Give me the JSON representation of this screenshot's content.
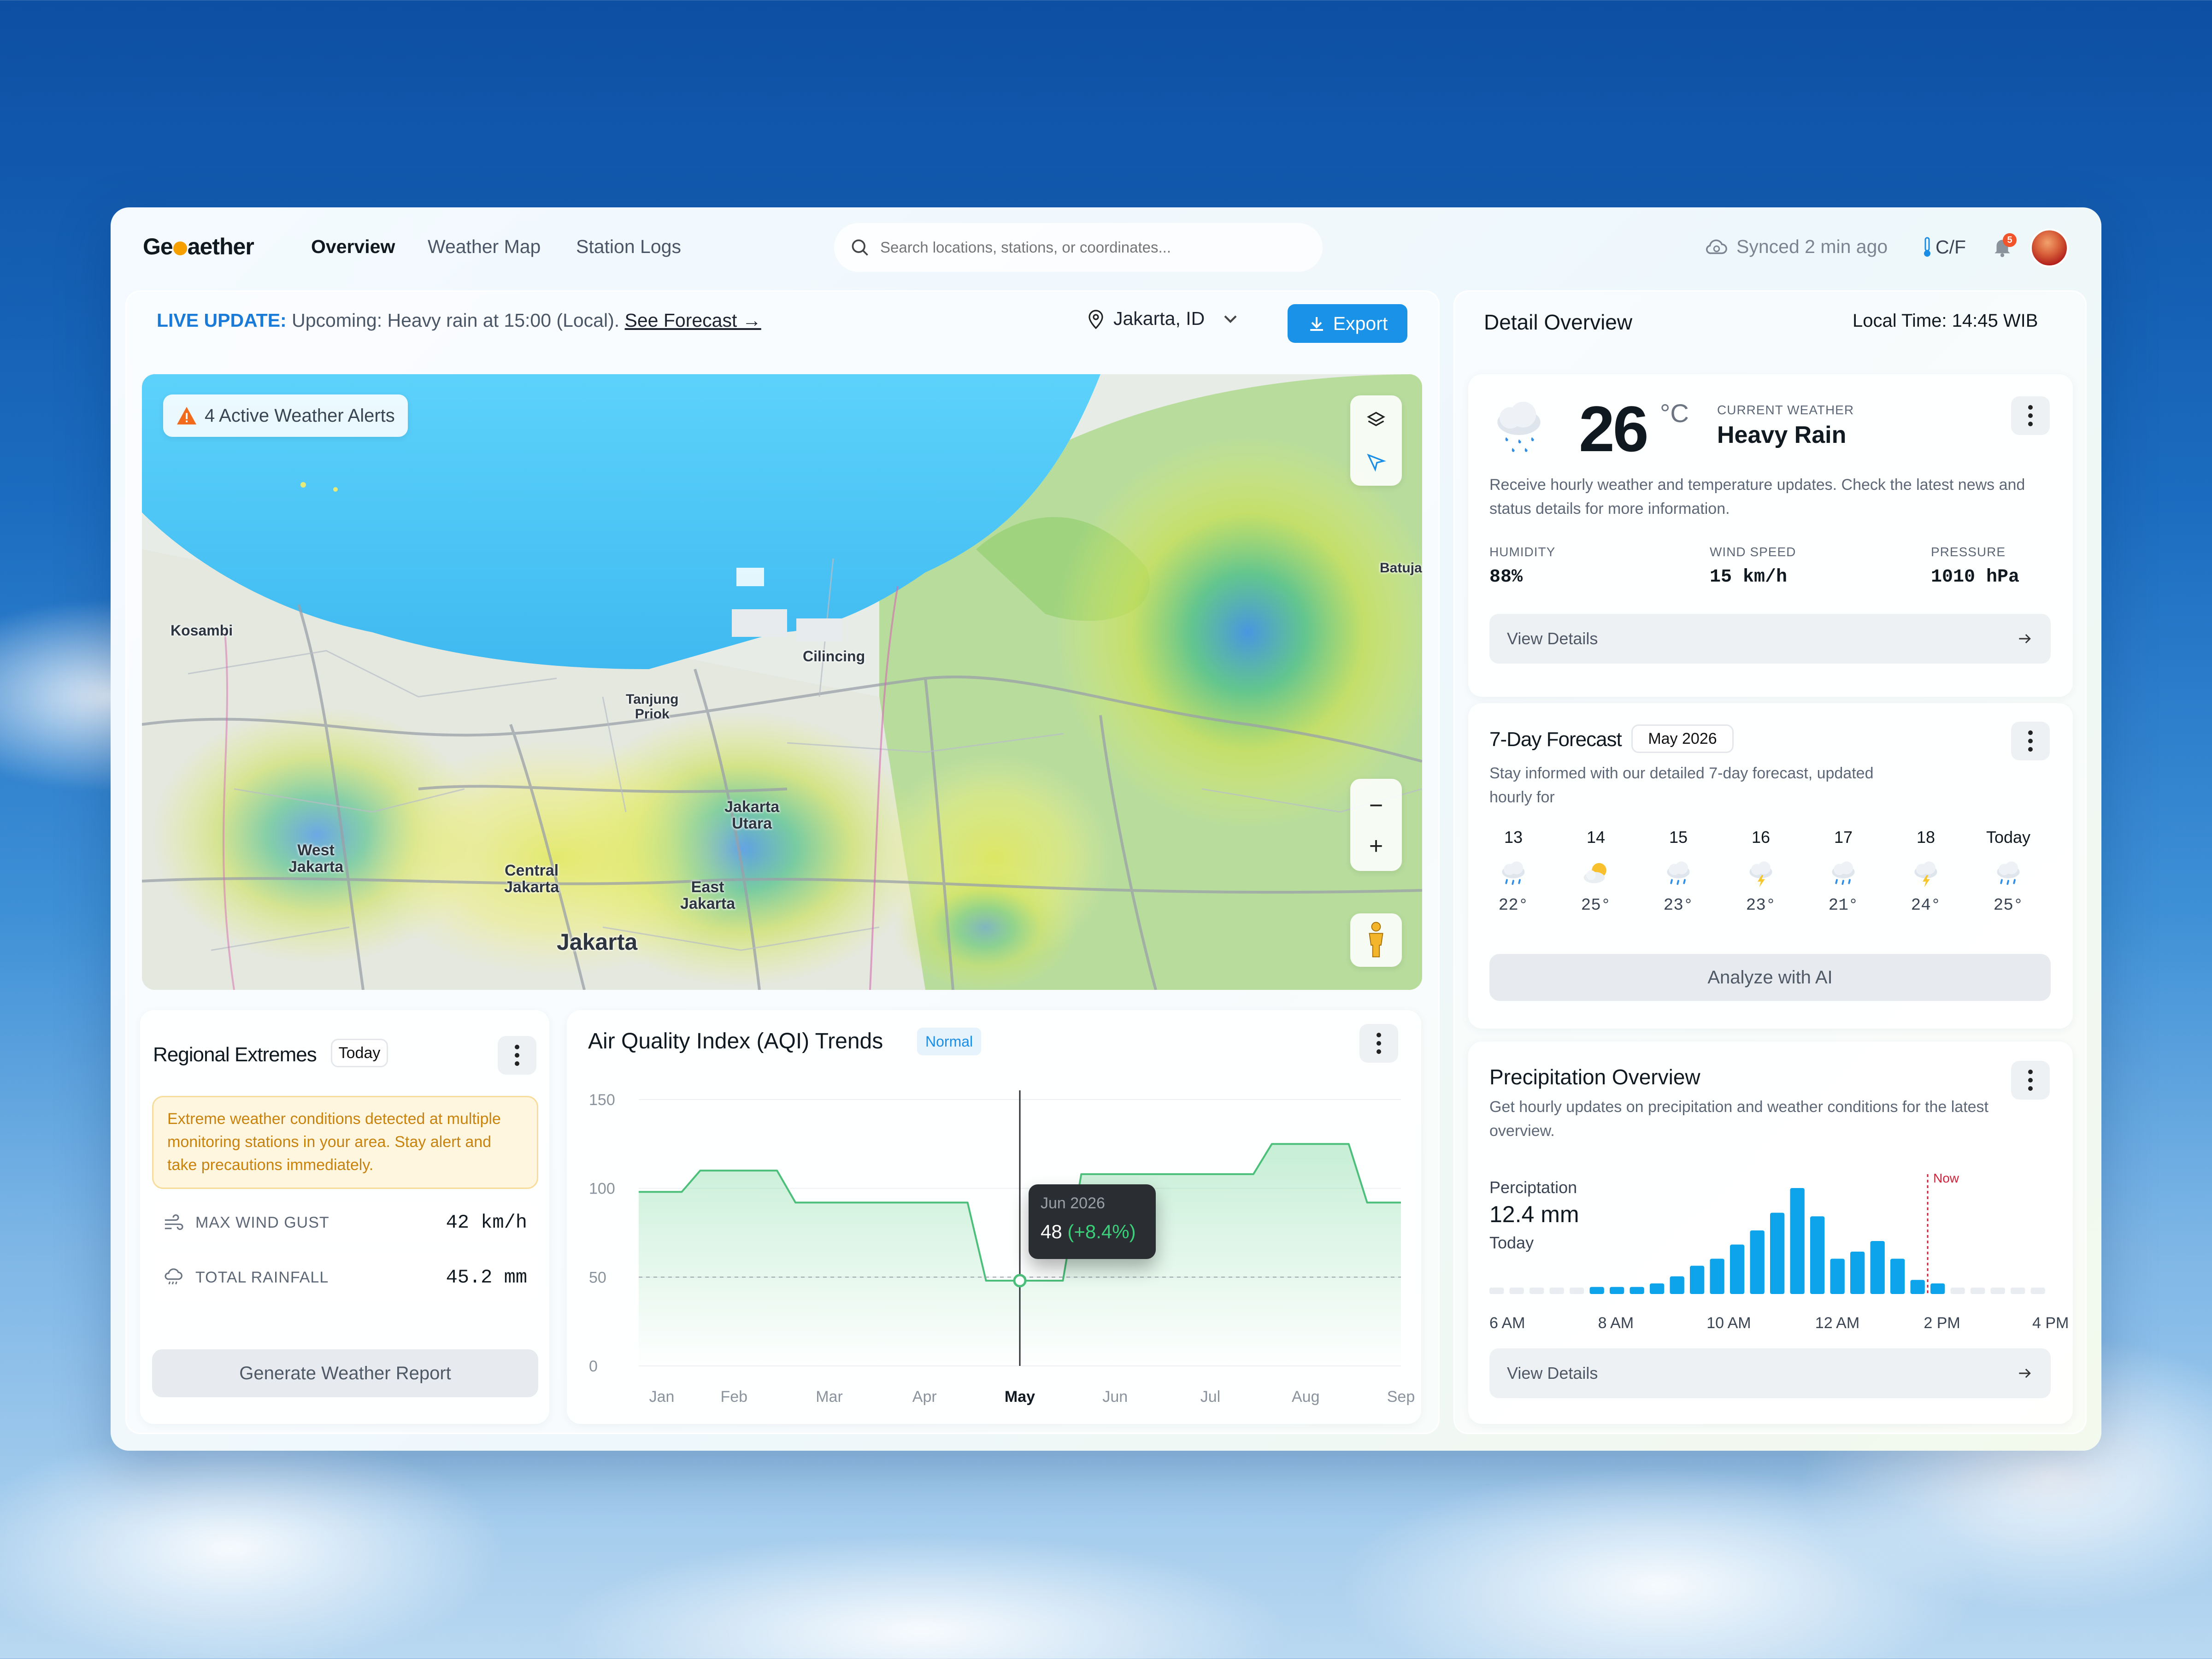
{
  "header": {
    "logo_pre": "Ge",
    "logo_post": "aether",
    "nav": [
      "Overview",
      "Weather Map",
      "Station Logs"
    ],
    "search_placeholder": "Search locations, stations, or coordinates...",
    "sync_status": "Synced 2 min ago",
    "unit_toggle": "C/F",
    "notification_count": "5"
  },
  "live": {
    "label": "LIVE UPDATE:",
    "message": "Upcoming: Heavy rain at 15:00 (Local).",
    "link": "See Forecast →",
    "location": "Jakarta, ID",
    "export": "Export"
  },
  "map": {
    "alerts": "4 Active Weather Alerts",
    "labels": {
      "kosambi": "Kosambi",
      "cilincing": "Cilincing",
      "tanjung": "Tanjung\nPriok",
      "west": "West\nJakarta",
      "central": "Central\nJakarta",
      "utara": "Jakarta\nUtara",
      "east": "East\nJakarta",
      "jakarta": "Jakarta",
      "batuja": "Batuja"
    },
    "zoom_out": "−",
    "zoom_in": "+"
  },
  "extremes": {
    "title": "Regional Extremes",
    "badge": "Today",
    "warning": "Extreme weather conditions detected at multiple monitoring stations in your area. Stay alert and take precautions immediately.",
    "rows": [
      {
        "label": "MAX WIND GUST",
        "value": "42 km/h",
        "icon": "wind-icon"
      },
      {
        "label": "TOTAL RAINFALL",
        "value": "45.2 mm",
        "icon": "rain-cloud-icon"
      }
    ],
    "button": "Generate Weather Report"
  },
  "aqi": {
    "title": "Air Quality Index (AQI) Trends",
    "badge": "Normal",
    "tooltip_date": "Jun 2026",
    "tooltip_value": "48",
    "tooltip_change": "(+8.4%)"
  },
  "chart_data": [
    {
      "type": "area",
      "title": "Air Quality Index (AQI) Trends",
      "categories": [
        "Jan",
        "Feb",
        "Mar",
        "Apr",
        "May",
        "Jun",
        "Jul",
        "Aug",
        "Sep"
      ],
      "highlight": "May",
      "series": [
        {
          "values": [
            98,
            110,
            92,
            92,
            48,
            108,
            108,
            125,
            92
          ]
        }
      ],
      "ylim": [
        0,
        150
      ],
      "yticks": [
        0,
        50,
        100,
        150
      ],
      "baseline": 50
    },
    {
      "type": "bar",
      "title": "Precipitation Overview",
      "xticks": [
        "6 AM",
        "8 AM",
        "10 AM",
        "12 AM",
        "2 PM",
        "4 PM"
      ],
      "now_label": "Now",
      "series": [
        {
          "values": [
            0,
            0,
            0,
            0,
            0,
            2,
            2,
            2,
            3,
            5,
            8,
            10,
            14,
            18,
            23,
            30,
            22,
            10,
            12,
            15,
            10,
            4,
            3,
            0,
            0,
            0,
            0,
            0
          ]
        }
      ]
    }
  ],
  "detail": {
    "title": "Detail Overview",
    "local_time": "Local Time: 14:45 WIB"
  },
  "current": {
    "temp": "26",
    "unit": "°C",
    "label": "CURRENT WEATHER",
    "condition": "Heavy Rain",
    "description": "Receive hourly weather and temperature updates. Check the latest news and status details for more information.",
    "stats": [
      {
        "label": "HUMIDITY",
        "value": "88%"
      },
      {
        "label": "WIND SPEED",
        "value": "15 km/h"
      },
      {
        "label": "PRESSURE",
        "value": "1010 hPa"
      }
    ],
    "button": "View Details"
  },
  "forecast": {
    "title": "7-Day Forecast",
    "badge": "May 2026",
    "description": "Stay informed with our detailed 7-day forecast, updated hourly for",
    "days": [
      {
        "d": "13",
        "t": "22°",
        "icon": "rain-icon"
      },
      {
        "d": "14",
        "t": "25°",
        "icon": "partly-sunny-icon"
      },
      {
        "d": "15",
        "t": "23°",
        "icon": "rain-icon"
      },
      {
        "d": "16",
        "t": "23°",
        "icon": "thunder-icon"
      },
      {
        "d": "17",
        "t": "21°",
        "icon": "rain-icon"
      },
      {
        "d": "18",
        "t": "24°",
        "icon": "thunder-icon"
      },
      {
        "d": "Today",
        "t": "25°",
        "icon": "rain-icon"
      }
    ],
    "button": "Analyze with AI"
  },
  "precip": {
    "title": "Precipitation Overview",
    "description": "Get hourly updates on precipitation and weather conditions for the latest overview.",
    "label": "Perciptation",
    "value": "12.4 mm",
    "period": "Today",
    "button": "View Details"
  },
  "colors": {
    "accent": "#1a8ee6",
    "bar": "#0ea4ec",
    "warn_bg": "#fff6e0",
    "warn_text": "#c8830f"
  }
}
